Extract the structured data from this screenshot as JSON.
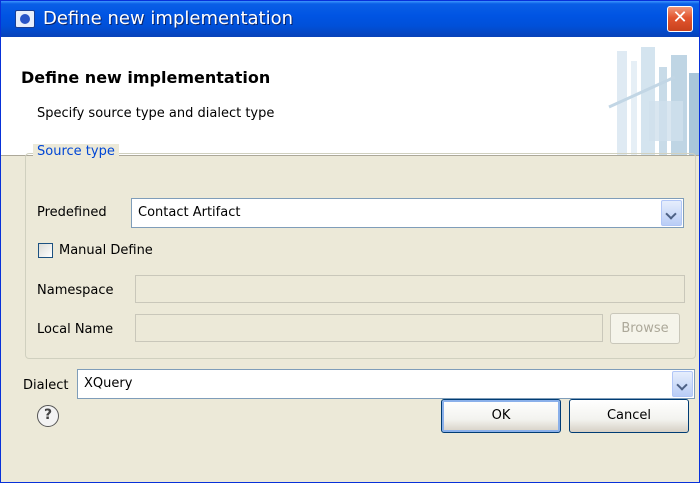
{
  "window": {
    "title": "Define new implementation",
    "close_glyph": "✕",
    "icon": "app-icon"
  },
  "header": {
    "title": "Define new implementation",
    "subtitle": "Specify source type and dialect type"
  },
  "source_type": {
    "group_label": "Source type",
    "predefined_label": "Predefined",
    "predefined_value": "Contact Artifact",
    "manual_define_label": "Manual Define",
    "manual_define_checked": false,
    "namespace_label": "Namespace",
    "namespace_value": "",
    "local_name_label": "Local Name",
    "local_name_value": "",
    "browse_label": "Browse"
  },
  "dialect": {
    "label": "Dialect",
    "value": "XQuery"
  },
  "footer": {
    "help_glyph": "?",
    "ok_label": "OK",
    "cancel_label": "Cancel"
  },
  "colors": {
    "title_bar": "#0054e3",
    "group_label": "#0046d5",
    "dialog_bg": "#ece9d8",
    "close_button": "#e2552f"
  }
}
